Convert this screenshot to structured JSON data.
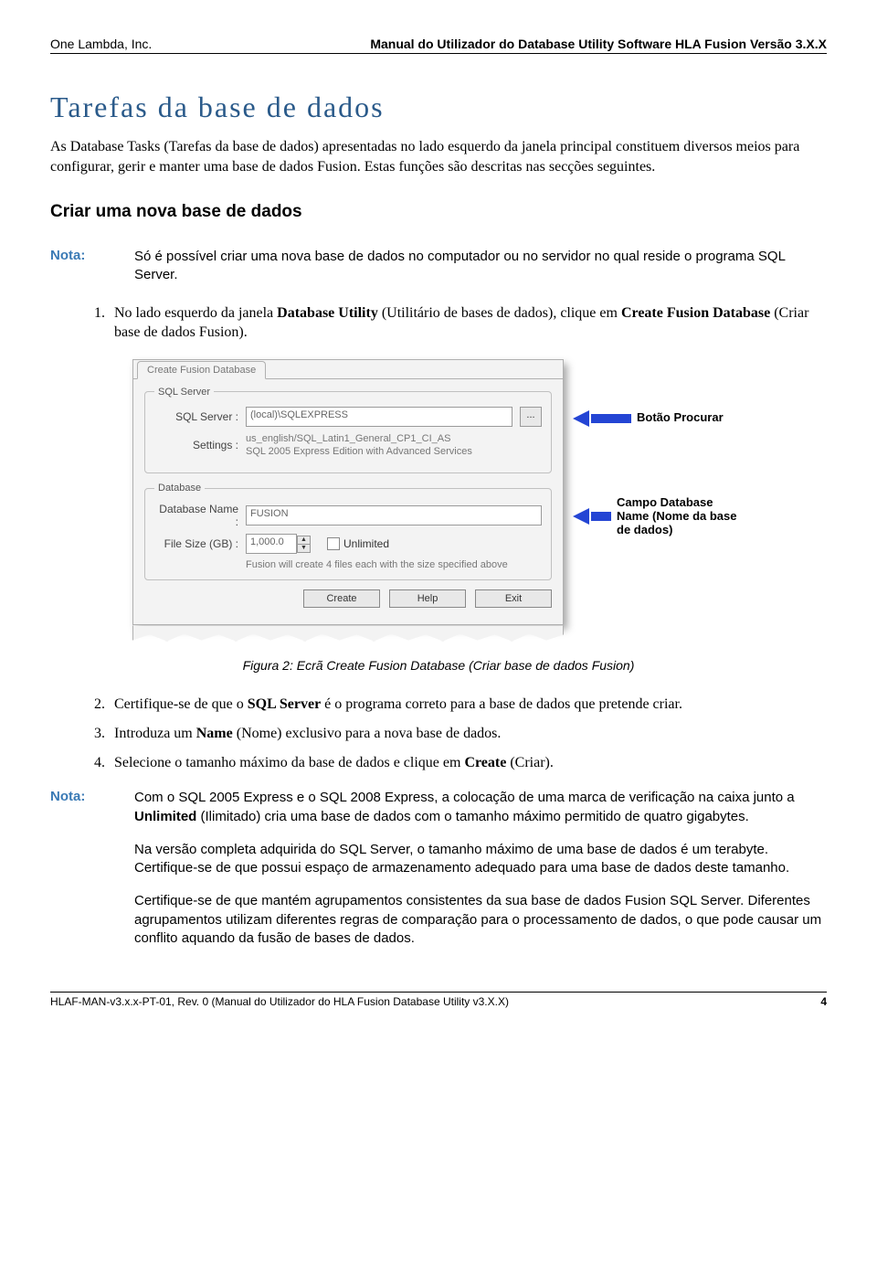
{
  "header": {
    "left": "One Lambda, Inc.",
    "right": "Manual do Utilizador do Database Utility Software HLA Fusion Versão 3.X.X"
  },
  "h1": "Tarefas da base de dados",
  "intro": "As Database Tasks (Tarefas da base de dados) apresentadas no lado esquerdo da janela principal constituem diversos meios para configurar, gerir e manter uma base de dados Fusion. Estas funções são descritas nas secções seguintes.",
  "h2": "Criar uma nova base de dados",
  "note1_label": "Nota:",
  "note1_body": "Só é possível criar uma nova base de dados no computador ou no servidor no qual reside o programa SQL Server.",
  "step1_pre": "No lado esquerdo da janela ",
  "step1_bold1": "Database Utility",
  "step1_mid": " (Utilitário de bases de dados), clique em ",
  "step1_bold2": "Create Fusion Database",
  "step1_post": " (Criar base de dados Fusion).",
  "dialog": {
    "tab": "Create Fusion Database",
    "legend_sql": "SQL Server",
    "lbl_sqlserver": "SQL Server :",
    "val_sqlserver": "(local)\\SQLEXPRESS",
    "ellipsis": "...",
    "lbl_settings": "Settings :",
    "val_settings_line1": "us_english/SQL_Latin1_General_CP1_CI_AS",
    "val_settings_line2": "SQL 2005 Express Edition with Advanced Services",
    "legend_db": "Database",
    "lbl_dbname": "Database Name :",
    "val_dbname": "FUSION",
    "lbl_filesize": "File Size (GB) :",
    "val_filesize": "1,000.0",
    "lbl_unlimited": "Unlimited",
    "smallnote": "Fusion will create 4 files each with the size specified above",
    "btn_create": "Create",
    "btn_help": "Help",
    "btn_exit": "Exit"
  },
  "callout1": "Botão Procurar",
  "callout2": "Campo Database Name (Nome da base de dados)",
  "fig_caption": "Figura 2: Ecrã Create Fusion Database (Criar base de dados Fusion)",
  "step2_pre": "Certifique-se de que o ",
  "step2_bold": "SQL Server",
  "step2_post": " é o programa correto para a base de dados que pretende criar.",
  "step3_pre": "Introduza um ",
  "step3_bold": "Name",
  "step3_post": " (Nome) exclusivo para a nova base de dados.",
  "step4_pre": "Selecione o tamanho máximo da base de dados e clique em ",
  "step4_bold": "Create",
  "step4_post": " (Criar).",
  "note2_label": "Nota:",
  "note2_p1_a": "Com o SQL 2005 Express e o SQL 2008 Express, a colocação de uma marca de verificação na caixa junto a ",
  "note2_p1_bold": "Unlimited",
  "note2_p1_b": " (Ilimitado) cria uma base de dados com o tamanho máximo permitido de quatro gigabytes.",
  "note2_p2": "Na versão completa adquirida do SQL Server, o tamanho máximo de uma base de dados é um terabyte. Certifique-se de que possui espaço de armazenamento adequado para uma base de dados deste tamanho.",
  "note2_p3": "Certifique-se de que mantém agrupamentos consistentes da sua base de dados Fusion SQL Server. Diferentes agrupamentos utilizam diferentes regras de comparação para o processamento de dados, o que pode causar um conflito aquando da fusão de bases de dados.",
  "footer": {
    "left": "HLAF-MAN-v3.x.x-PT-01, Rev. 0 (Manual do Utilizador do HLA Fusion Database Utility v3.X.X)",
    "right": "4"
  }
}
